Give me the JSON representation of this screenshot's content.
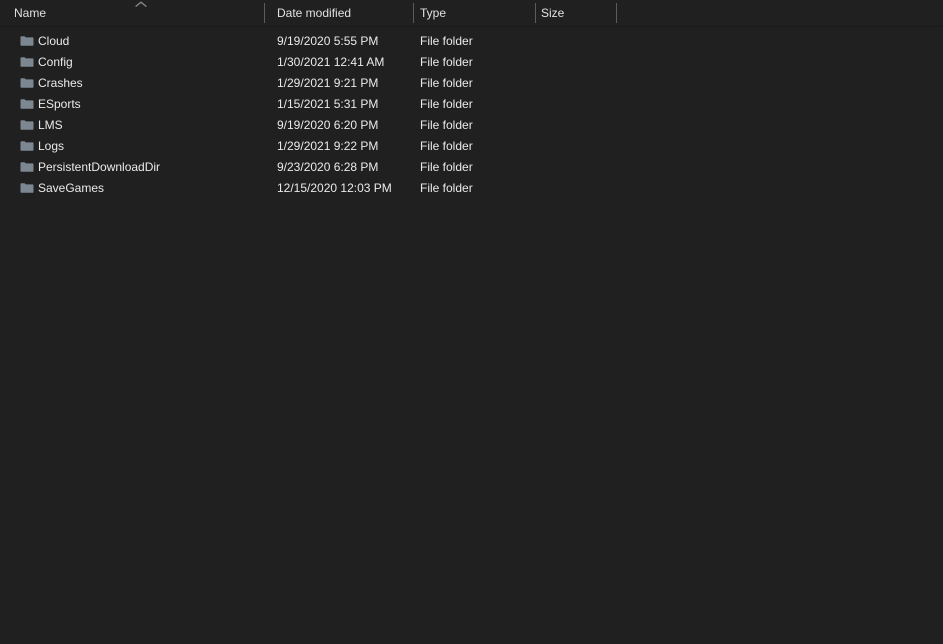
{
  "window": {
    "view_mode": "details",
    "theme": "dark",
    "background_color": "#202020",
    "text_color": "#eaeaea",
    "folder_icon_color": "#7c8792",
    "divider_color": "#5c5c5c"
  },
  "columns": [
    {
      "key": "name",
      "label": "Name",
      "sorted": true,
      "sort_direction": "ascending",
      "sort_icon": "chevron-up-icon"
    },
    {
      "key": "date_modified",
      "label": "Date modified",
      "sorted": false,
      "sort_direction": "",
      "sort_icon": ""
    },
    {
      "key": "type",
      "label": "Type",
      "sorted": false,
      "sort_direction": "",
      "sort_icon": ""
    },
    {
      "key": "size",
      "label": "Size",
      "sorted": false,
      "sort_direction": "",
      "sort_icon": ""
    }
  ],
  "files": [
    {
      "icon": "folder-icon",
      "name": "Cloud",
      "date_modified": "9/19/2020 5:55 PM",
      "type": "File folder",
      "size": ""
    },
    {
      "icon": "folder-icon",
      "name": "Config",
      "date_modified": "1/30/2021 12:41 AM",
      "type": "File folder",
      "size": ""
    },
    {
      "icon": "folder-icon",
      "name": "Crashes",
      "date_modified": "1/29/2021 9:21 PM",
      "type": "File folder",
      "size": ""
    },
    {
      "icon": "folder-icon",
      "name": "ESports",
      "date_modified": "1/15/2021 5:31 PM",
      "type": "File folder",
      "size": ""
    },
    {
      "icon": "folder-icon",
      "name": "LMS",
      "date_modified": "9/19/2020 6:20 PM",
      "type": "File folder",
      "size": ""
    },
    {
      "icon": "folder-icon",
      "name": "Logs",
      "date_modified": "1/29/2021 9:22 PM",
      "type": "File folder",
      "size": ""
    },
    {
      "icon": "folder-icon",
      "name": "PersistentDownloadDir",
      "date_modified": "9/23/2020 6:28 PM",
      "type": "File folder",
      "size": ""
    },
    {
      "icon": "folder-icon",
      "name": "SaveGames",
      "date_modified": "12/15/2020 12:03 PM",
      "type": "File folder",
      "size": ""
    }
  ]
}
